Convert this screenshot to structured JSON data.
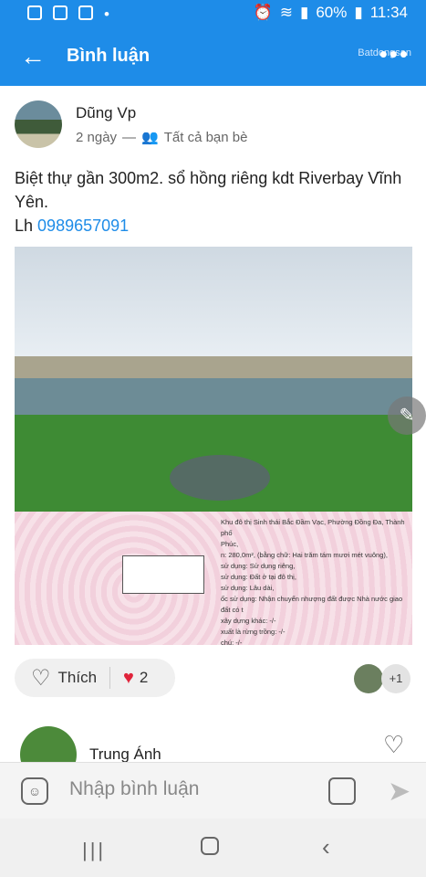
{
  "status_bar": {
    "battery": "60%",
    "time": "11:34"
  },
  "watermark": "Batdongsan",
  "header": {
    "title": "Bình luận",
    "more": "•••"
  },
  "post": {
    "author": "Dũng Vp",
    "time": "2 ngày",
    "separator": "—",
    "audience": "Tất cả bạn bè",
    "text": "Biệt thự gần 300m2. sổ hồng riêng kdt Riverbay Vĩnh Yên.",
    "contact_prefix": "Lh",
    "phone": "0989657091",
    "doc_text": [
      "Khu đô thị Sinh thái Bắc Đầm Vạc, Phường Đồng Đa, Thành phố",
      "Phúc,",
      "n: 280,0m², (bằng chữ: Hai trăm tám mươi mét vuông),",
      "sử dụng: Sử dụng riêng,",
      "sử dụng: Đất ở tại đô thị,",
      "sử dụng: Lâu dài,",
      "ốc sử dụng: Nhận chuyển nhượng đất được Nhà nước giao đất có t",
      "xây dựng khác: -/-",
      "xuất là rừng trồng: -/-",
      "chú: -/-"
    ]
  },
  "reactions": {
    "like_label": "Thích",
    "count": "2",
    "viewers_more": "+1"
  },
  "comment": {
    "author": "Trung Ánh"
  },
  "input": {
    "placeholder": "Nhập bình luận"
  },
  "colors": {
    "accent": "#1e8ce8",
    "heart": "#e0243b"
  }
}
